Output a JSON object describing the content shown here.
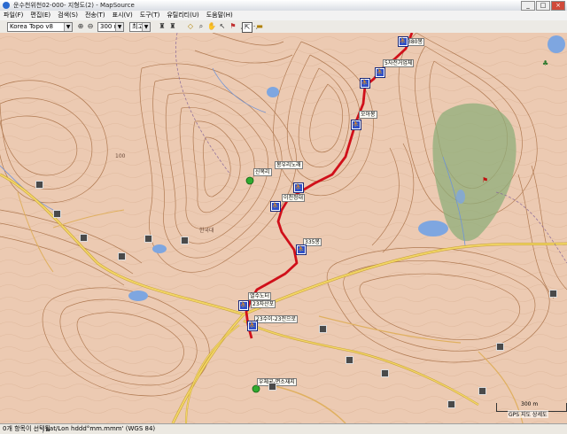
{
  "window": {
    "title": "운수천위천02-000- 지형도(2) - MapSource"
  },
  "window_controls": {
    "minimize": "_",
    "maximize": "□",
    "close": "×"
  },
  "menu": [
    "파일(F)",
    "편집(E)",
    "검색(S)",
    "전송(T)",
    "표시(V)",
    "도구(T)",
    "유틸리티(U)",
    "도움말(H)"
  ],
  "toolbar": {
    "map_product": "Korea Topo v8",
    "zoom_level": "300 m",
    "detail": "최고",
    "zoom_in": "⊕",
    "zoom_out": "⊖"
  },
  "map": {
    "waypoints": [
      {
        "label": "380봉"
      },
      {
        "label": "5자전거업체"
      },
      {
        "label": "오아봉"
      },
      {
        "label": "봉우리노래"
      },
      {
        "label": "이천정대"
      },
      {
        "label": "335봉"
      },
      {
        "label": "열수노터"
      },
      {
        "label": "23자산포"
      },
      {
        "label": "23수이-23전으로"
      },
      {
        "label": "신목리"
      },
      {
        "label": "우체국-면소재지"
      }
    ],
    "labels": [
      "100",
      "한국대"
    ],
    "scale_label": "300 m",
    "gps_label": "GPS 지도 상세도"
  },
  "status": {
    "selection": "0개 항목이 선택됨",
    "coord_format": "Lat/Lon hddd°mm.mmm' (WGS 84)"
  },
  "colors": {
    "map_background": "#eccab2",
    "contour": "#b07a52",
    "route": "#d0101a",
    "road": "#f0c840",
    "water": "#7ea6e0",
    "forest": "#8fae7a"
  }
}
